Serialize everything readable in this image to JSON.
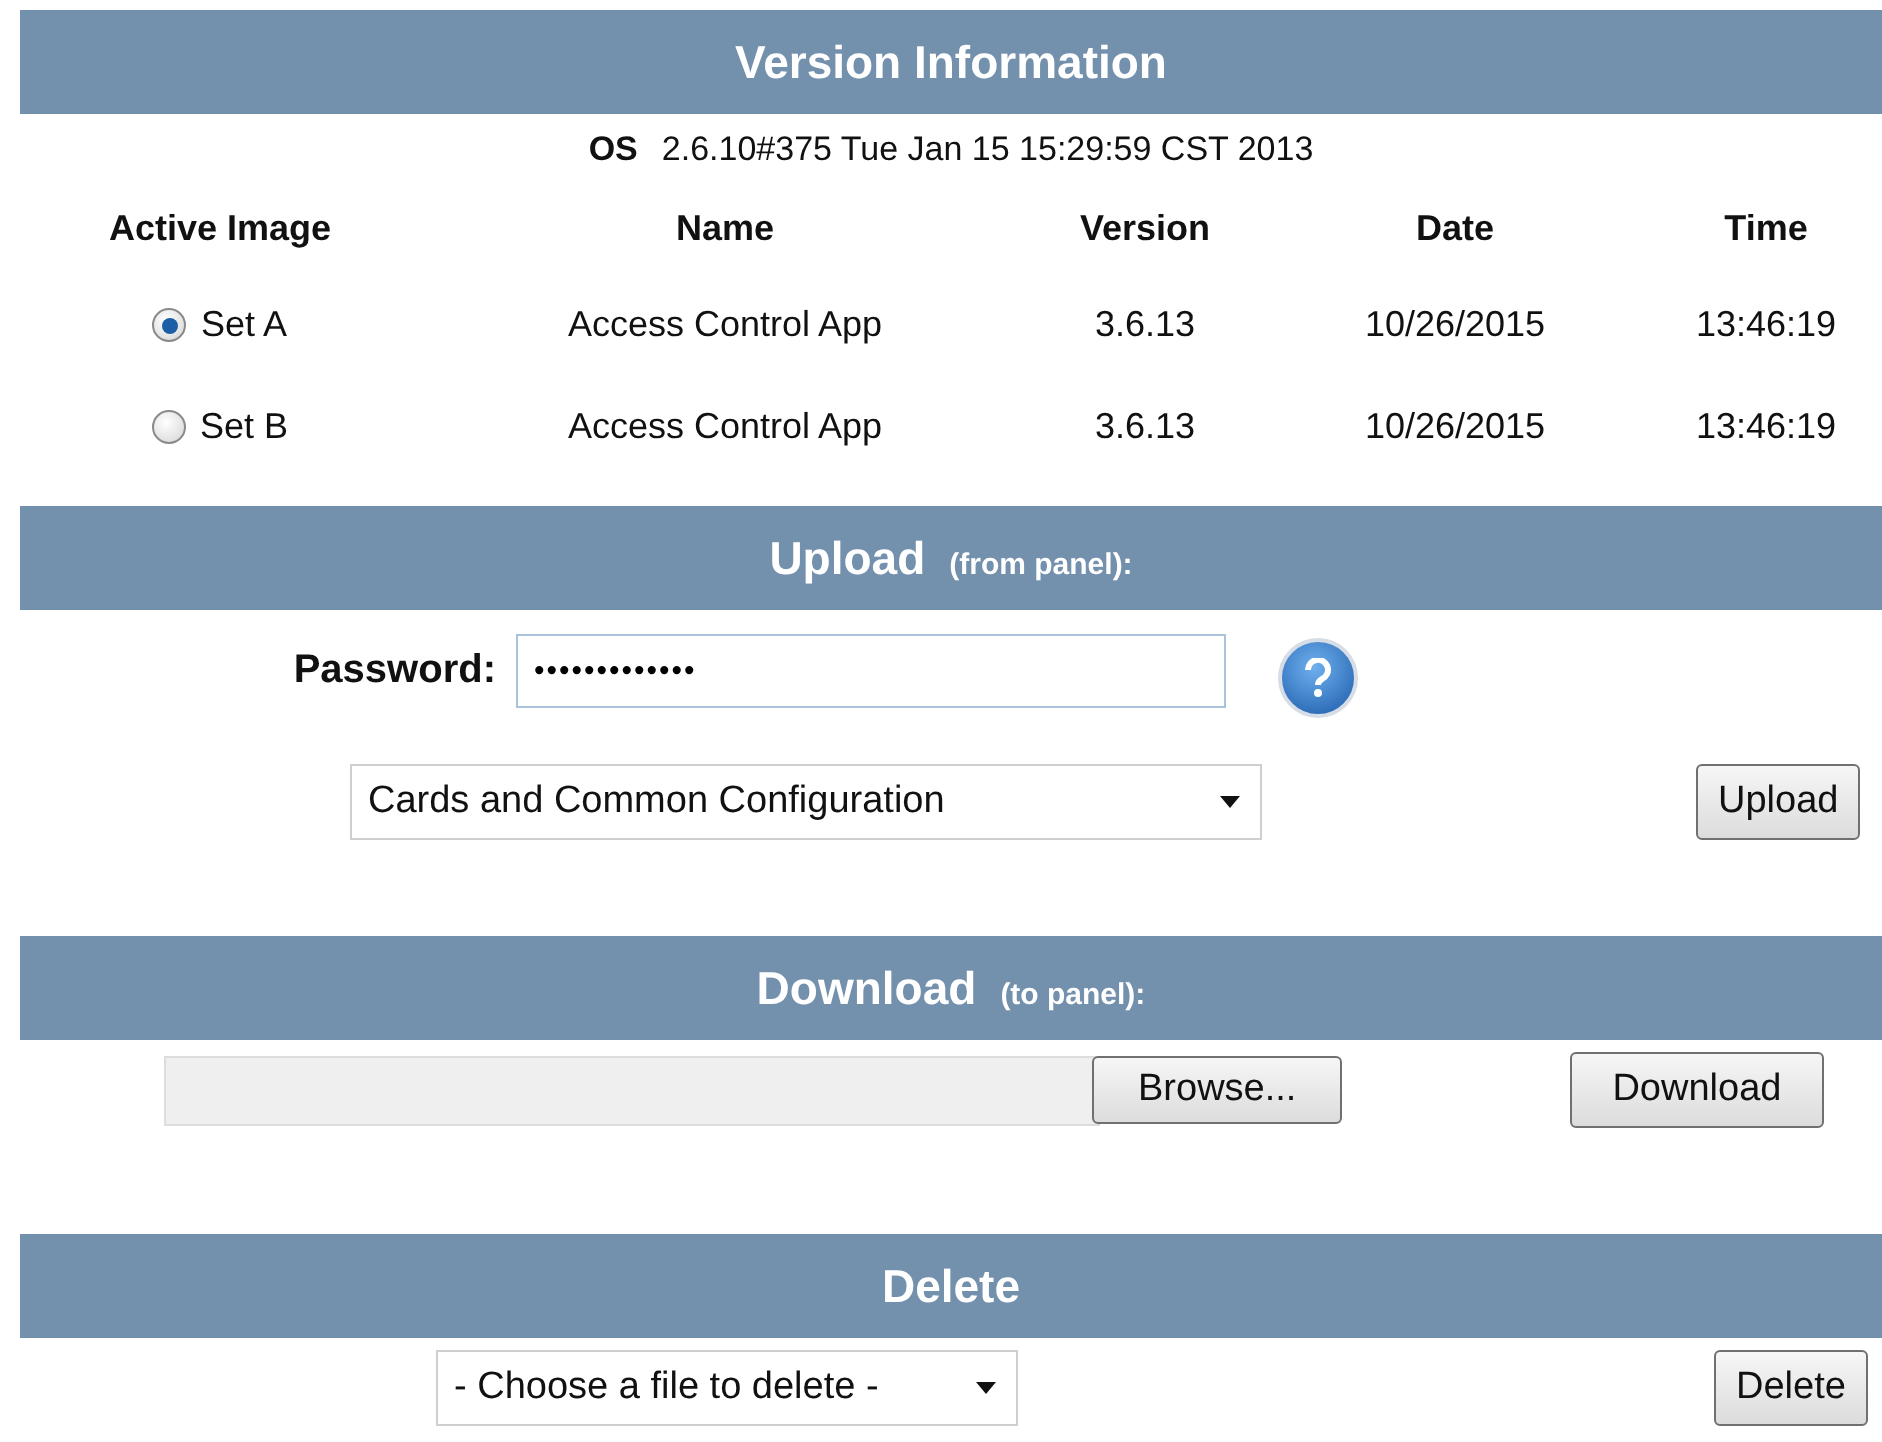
{
  "version_info": {
    "title": "Version Information",
    "os_label": "OS",
    "os_value": "2.6.10#375 Tue Jan 15 15:29:59 CST 2013",
    "columns": [
      "Active Image",
      "Name",
      "Version",
      "Date",
      "Time"
    ],
    "rows": [
      {
        "set": "Set A",
        "selected": true,
        "name": "Access Control App",
        "version": "3.6.13",
        "date": "10/26/2015",
        "time": "13:46:19"
      },
      {
        "set": "Set B",
        "selected": false,
        "name": "Access Control App",
        "version": "3.6.13",
        "date": "10/26/2015",
        "time": "13:46:19"
      }
    ]
  },
  "upload": {
    "title": "Upload",
    "subtitle": "(from panel):",
    "password_label": "Password:",
    "password_value": "•••••••••••••",
    "select_value": "Cards and Common Configuration",
    "button": "Upload"
  },
  "download": {
    "title": "Download",
    "subtitle": "(to panel):",
    "browse_button": "Browse...",
    "button": "Download"
  },
  "delete": {
    "title": "Delete",
    "select_value": "- Choose a file to delete -",
    "button": "Delete"
  }
}
